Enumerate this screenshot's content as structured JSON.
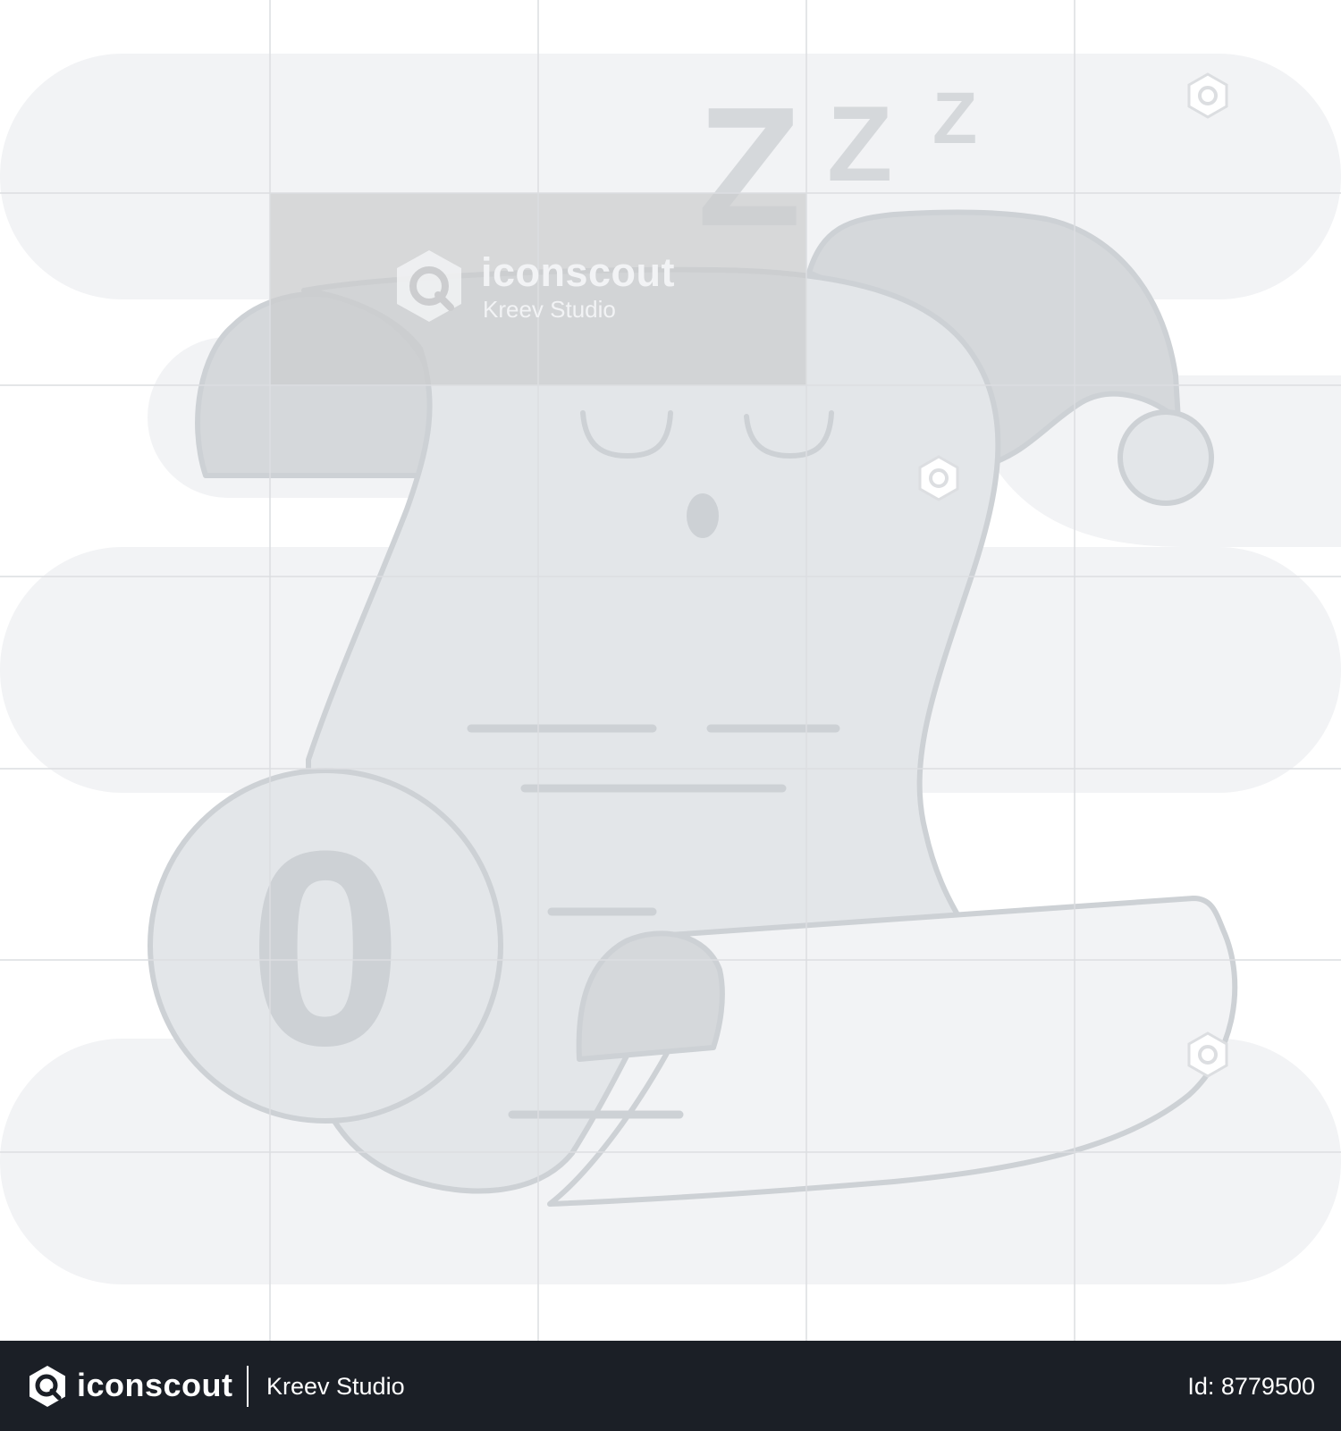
{
  "watermark": {
    "brand": "iconscout",
    "studio": "Kreev Studio"
  },
  "illustration": {
    "snore": [
      "Z",
      "Z",
      "Z"
    ],
    "counter_digit": "0",
    "colors": {
      "background_blob": "#f2f3f5",
      "paper_fill": "#e3e6e9",
      "outline": "#cdd1d5",
      "dark_fill": "#d5d8db",
      "watermark_band": "#cccdcf",
      "grid_line": "#dcdee1"
    }
  },
  "footer": {
    "brand": "iconscout",
    "studio": "Kreev Studio",
    "id_label": "Id: 8779500",
    "background": "#1b1f26"
  }
}
